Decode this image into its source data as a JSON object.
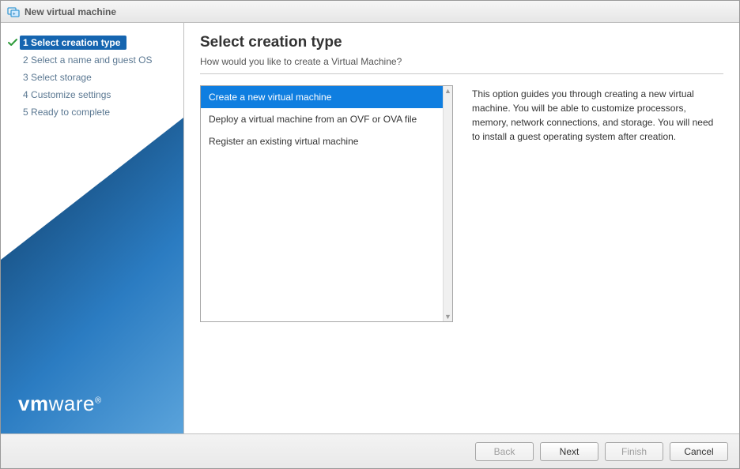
{
  "window": {
    "title": "New virtual machine"
  },
  "steps": [
    {
      "num": "1",
      "label": "Select creation type",
      "active": true,
      "checked": true
    },
    {
      "num": "2",
      "label": "Select a name and guest OS",
      "active": false,
      "checked": false
    },
    {
      "num": "3",
      "label": "Select storage",
      "active": false,
      "checked": false
    },
    {
      "num": "4",
      "label": "Customize settings",
      "active": false,
      "checked": false
    },
    {
      "num": "5",
      "label": "Ready to complete",
      "active": false,
      "checked": false
    }
  ],
  "main": {
    "heading": "Select creation type",
    "subtitle": "How would you like to create a Virtual Machine?",
    "options": [
      "Create a new virtual machine",
      "Deploy a virtual machine from an OVF or OVA file",
      "Register an existing virtual machine"
    ],
    "description": "This option guides you through creating a new virtual machine. You will be able to customize processors, memory, network connections, and storage. You will need to install a guest operating system after creation."
  },
  "buttons": {
    "back": "Back",
    "next": "Next",
    "finish": "Finish",
    "cancel": "Cancel"
  },
  "branding": {
    "logo_bold": "vm",
    "logo_thin": "ware",
    "reg": "®"
  }
}
